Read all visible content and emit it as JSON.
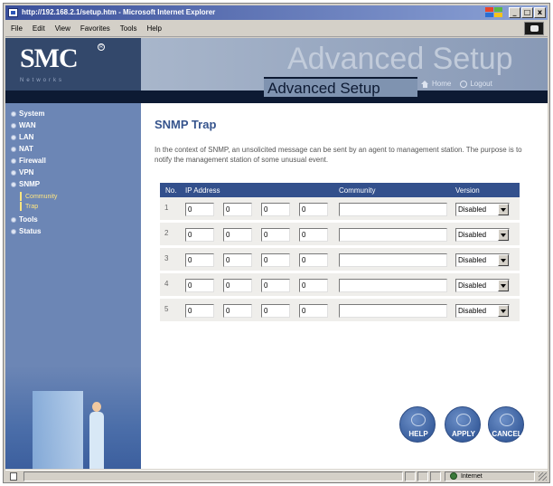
{
  "window": {
    "title": "http://192.168.2.1/setup.htm - Microsoft Internet Explorer",
    "controls": [
      "_",
      "□",
      "x"
    ]
  },
  "menu": [
    "File",
    "Edit",
    "View",
    "Favorites",
    "Tools",
    "Help"
  ],
  "header": {
    "logo": "SMC",
    "logo_sub": "Networks",
    "ghost_text": "Advanced Setup",
    "tab_title": "Advanced Setup",
    "home": "Home",
    "logout": "Logout"
  },
  "sidebar": {
    "items": [
      "System",
      "WAN",
      "LAN",
      "NAT",
      "Firewall",
      "VPN",
      "SNMP",
      "Tools",
      "Status"
    ],
    "sub_items": [
      "Community",
      "Trap"
    ],
    "active_sub": "Trap"
  },
  "content": {
    "title": "SNMP Trap",
    "description": "In the context of SNMP, an unsolicited message can be sent by an agent to management station. The purpose is to notify the management station of some unusual event.",
    "columns": [
      "No.",
      "IP Address",
      "Community",
      "Version"
    ],
    "rows": [
      {
        "no": "1",
        "ip": [
          "0",
          "0",
          "0",
          "0"
        ],
        "community": "",
        "version": "Disabled"
      },
      {
        "no": "2",
        "ip": [
          "0",
          "0",
          "0",
          "0"
        ],
        "community": "",
        "version": "Disabled"
      },
      {
        "no": "3",
        "ip": [
          "0",
          "0",
          "0",
          "0"
        ],
        "community": "",
        "version": "Disabled"
      },
      {
        "no": "4",
        "ip": [
          "0",
          "0",
          "0",
          "0"
        ],
        "community": "",
        "version": "Disabled"
      },
      {
        "no": "5",
        "ip": [
          "0",
          "0",
          "0",
          "0"
        ],
        "community": "",
        "version": "Disabled"
      }
    ],
    "buttons": {
      "help": "HELP",
      "apply": "APPLY",
      "cancel": "CANCEL"
    }
  },
  "status": {
    "zone": "Internet"
  },
  "colors": {
    "sidebar": "#6c86b5",
    "table_header": "#33508c",
    "title": "#36548d",
    "logo_panel": "#33486b"
  }
}
